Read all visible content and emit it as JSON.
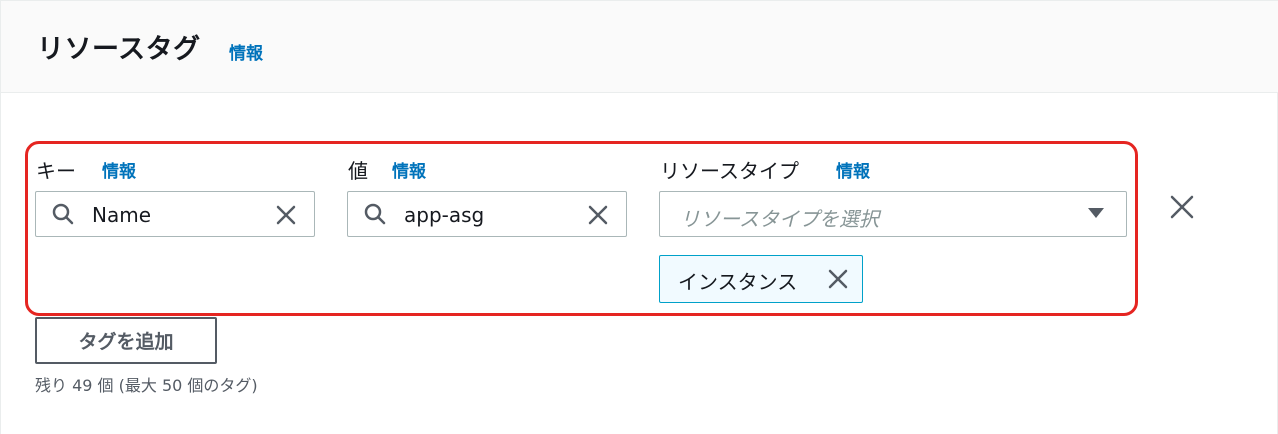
{
  "header": {
    "title": "リソースタグ",
    "info": "情報"
  },
  "tag_row": {
    "key": {
      "label": "キー",
      "info": "情報",
      "value": "Name"
    },
    "value": {
      "label": "値",
      "info": "情報",
      "value": "app-asg"
    },
    "resource_type": {
      "label": "リソースタイプ",
      "info": "情報",
      "placeholder": "リソースタイプを選択",
      "selected_tokens": [
        "インスタンス"
      ]
    }
  },
  "actions": {
    "add_tag": "タグを追加",
    "remaining_text": "残り 49 個 (最大 50 個のタグ)"
  },
  "colors": {
    "link": "#0073bb",
    "highlight": "#e52521",
    "token_bg": "#f1faff",
    "token_border": "#00a1c9"
  },
  "icons": [
    "search-icon",
    "close-icon",
    "caret-down-icon"
  ]
}
